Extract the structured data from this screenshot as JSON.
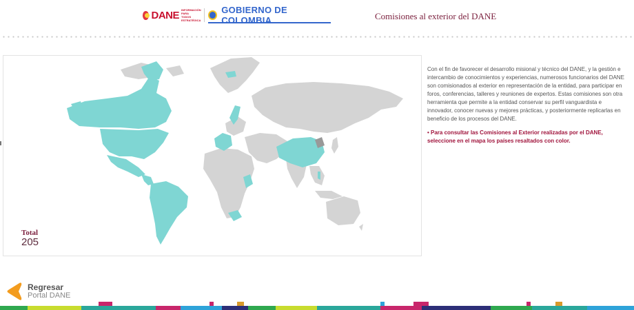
{
  "header": {
    "dane_logo_text": "DANE",
    "dane_logo_subtext": "INFORMACIÓN PARA TODOS ESTRATÉGICA",
    "gov_logo_text": "GOBIERNO DE COLOMBIA",
    "page_title": "Comisiones al exterior del DANE"
  },
  "map": {
    "highlight_color": "#7fd6d3",
    "base_color": "#d4d4d4",
    "selected_marker_color": "#999999",
    "total_label": "Total",
    "total_value": "205"
  },
  "info": {
    "description": "Con el fin de favorecer el desarrollo misional y técnico del DANE, y la gestión e intercambio de conocimientos y experiencias, numerosos funcionarios del DANE son comisionados al exterior en representación de la entidad, para participar en foros, conferencias, talleres y reuniones de expertos. Estas comisiones son otra herramienta que permite a la entidad conservar su perfil vanguardista e innovador, conocer nuevas y mejores prácticas, y posteriormente replicarlas en beneficio de los procesos del DANE.",
    "note": "• Para consultar las Comisiones al Exterior realizadas por el DANE, seleccione en el mapa los países resaltados con color."
  },
  "footer": {
    "back_label_line1": "Regresar",
    "back_label_line2": "Portal DANE",
    "accent_color": "#f39c1e"
  }
}
